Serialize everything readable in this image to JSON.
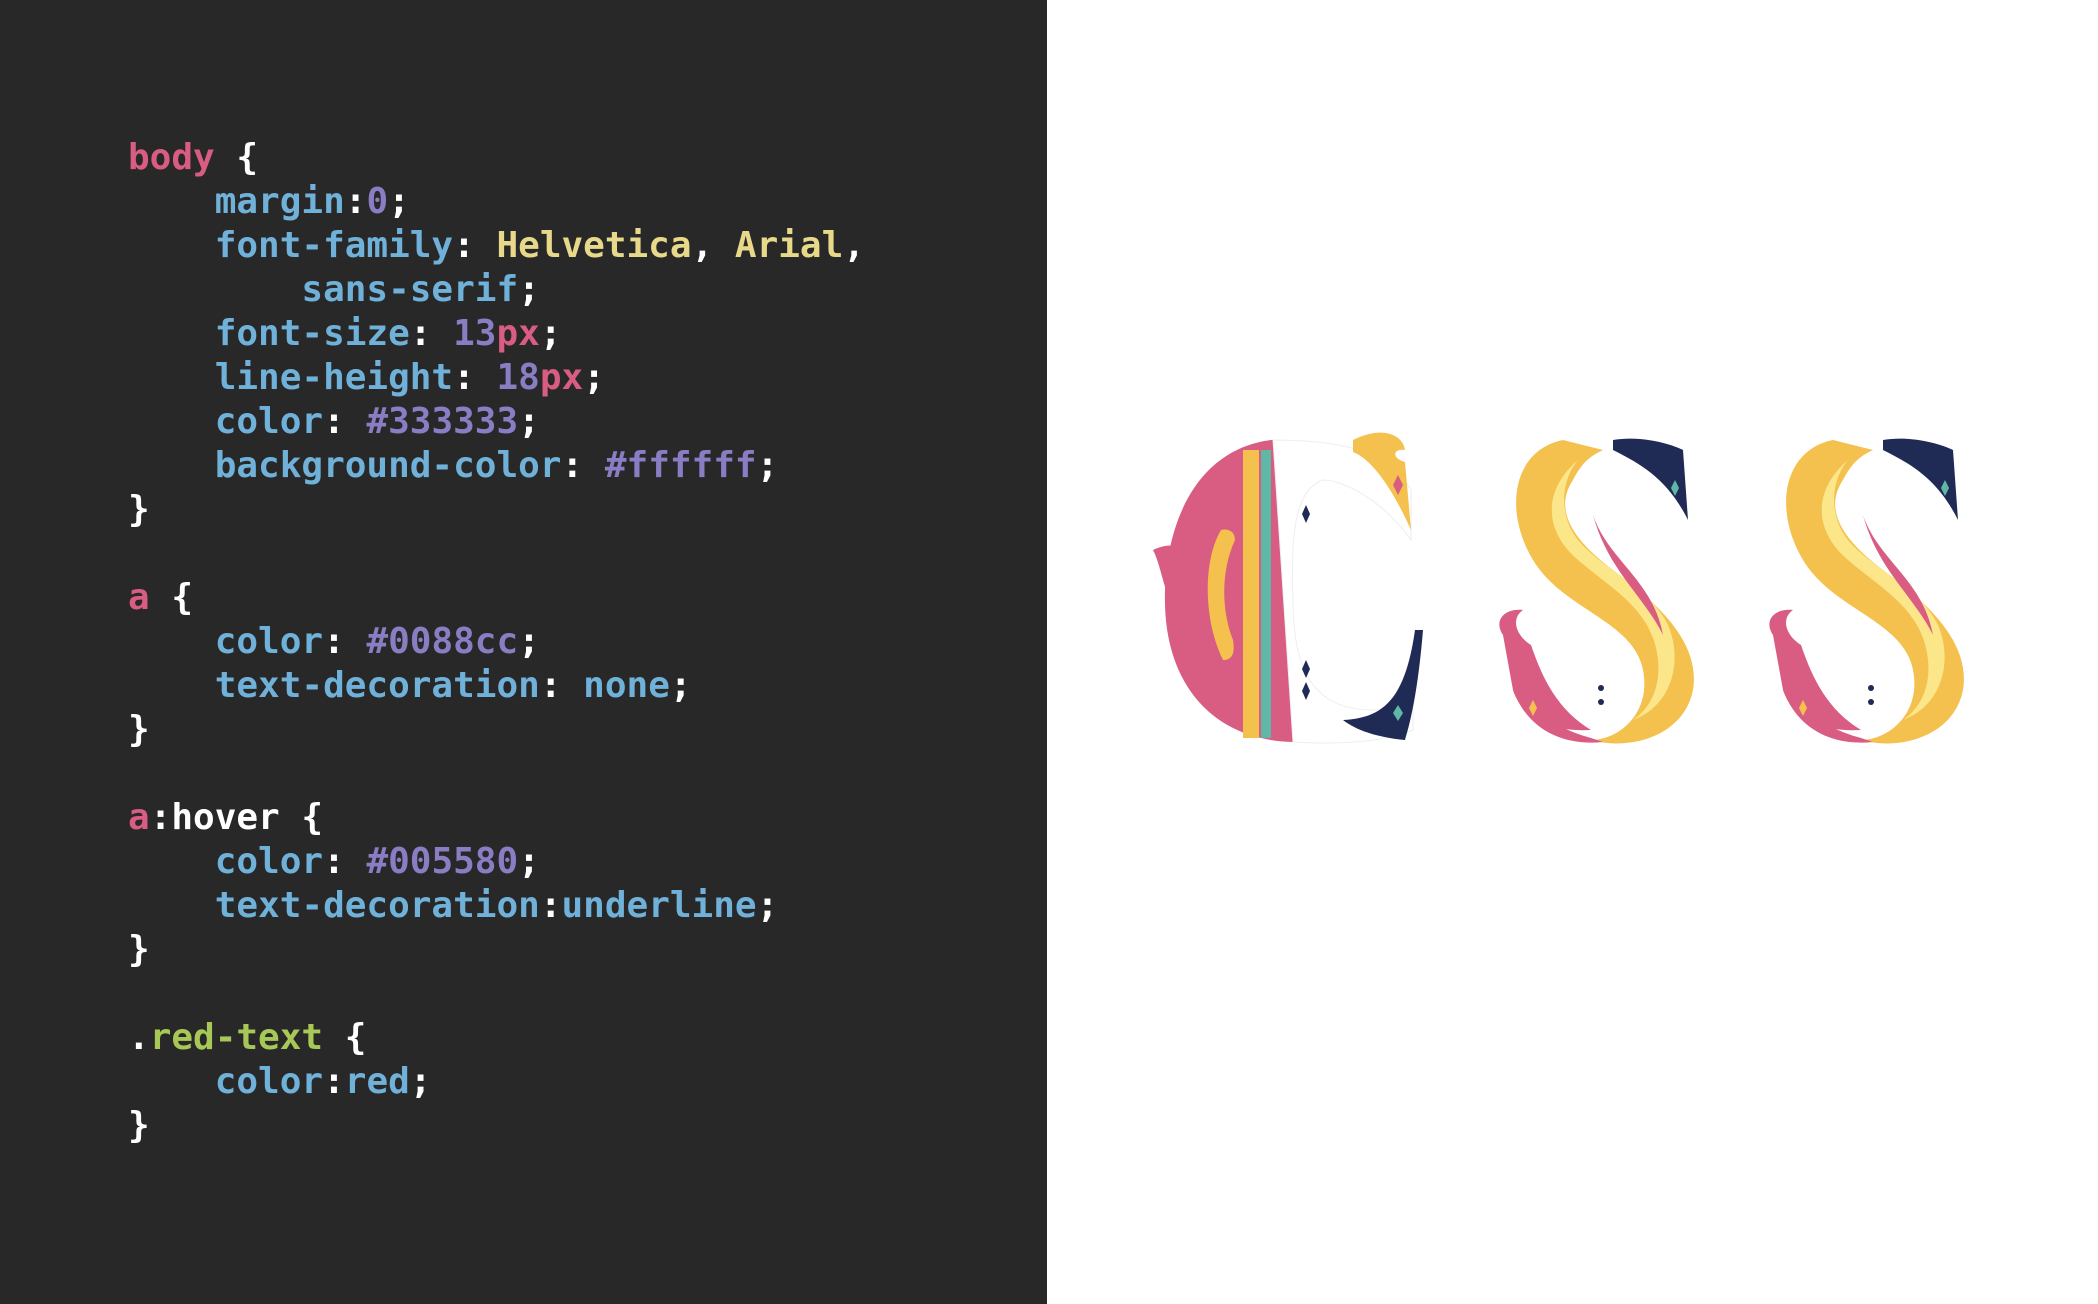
{
  "code_panel": {
    "lines": [
      [
        {
          "t": "body",
          "c": "sel"
        },
        {
          "t": " {",
          "c": "punct"
        }
      ],
      [
        {
          "t": "    margin",
          "c": "prop"
        },
        {
          "t": ":",
          "c": "punct"
        },
        {
          "t": "0",
          "c": "num"
        },
        {
          "t": ";",
          "c": "punct"
        }
      ],
      [
        {
          "t": "    font-family",
          "c": "prop"
        },
        {
          "t": ": ",
          "c": "punct"
        },
        {
          "t": "Helvetica",
          "c": "str"
        },
        {
          "t": ", ",
          "c": "punct"
        },
        {
          "t": "Arial",
          "c": "str"
        },
        {
          "t": ",",
          "c": "punct"
        }
      ],
      [
        {
          "t": "        sans-serif",
          "c": "kw"
        },
        {
          "t": ";",
          "c": "punct"
        }
      ],
      [
        {
          "t": "    font-size",
          "c": "prop"
        },
        {
          "t": ": ",
          "c": "punct"
        },
        {
          "t": "13",
          "c": "num"
        },
        {
          "t": "px",
          "c": "unit"
        },
        {
          "t": ";",
          "c": "punct"
        }
      ],
      [
        {
          "t": "    line-height",
          "c": "prop"
        },
        {
          "t": ": ",
          "c": "punct"
        },
        {
          "t": "18",
          "c": "num"
        },
        {
          "t": "px",
          "c": "unit"
        },
        {
          "t": ";",
          "c": "punct"
        }
      ],
      [
        {
          "t": "    color",
          "c": "prop"
        },
        {
          "t": ": ",
          "c": "punct"
        },
        {
          "t": "#333333",
          "c": "num"
        },
        {
          "t": ";",
          "c": "punct"
        }
      ],
      [
        {
          "t": "    background-color",
          "c": "prop"
        },
        {
          "t": ": ",
          "c": "punct"
        },
        {
          "t": "#ffffff",
          "c": "num"
        },
        {
          "t": ";",
          "c": "punct"
        }
      ],
      [
        {
          "t": "}",
          "c": "punct"
        }
      ],
      [],
      [
        {
          "t": "a",
          "c": "sel"
        },
        {
          "t": " {",
          "c": "punct"
        }
      ],
      [
        {
          "t": "    color",
          "c": "prop"
        },
        {
          "t": ": ",
          "c": "punct"
        },
        {
          "t": "#0088cc",
          "c": "num"
        },
        {
          "t": ";",
          "c": "punct"
        }
      ],
      [
        {
          "t": "    text-decoration",
          "c": "prop"
        },
        {
          "t": ": ",
          "c": "punct"
        },
        {
          "t": "none",
          "c": "kw"
        },
        {
          "t": ";",
          "c": "punct"
        }
      ],
      [
        {
          "t": "}",
          "c": "punct"
        }
      ],
      [],
      [
        {
          "t": "a",
          "c": "sel"
        },
        {
          "t": ":hover {",
          "c": "plain"
        }
      ],
      [
        {
          "t": "    color",
          "c": "prop"
        },
        {
          "t": ": ",
          "c": "punct"
        },
        {
          "t": "#005580",
          "c": "num"
        },
        {
          "t": ";",
          "c": "punct"
        }
      ],
      [
        {
          "t": "    text-decoration",
          "c": "prop"
        },
        {
          "t": ":",
          "c": "punct"
        },
        {
          "t": "underline",
          "c": "kw"
        },
        {
          "t": ";",
          "c": "punct"
        }
      ],
      [
        {
          "t": "}",
          "c": "punct"
        }
      ],
      [],
      [
        {
          "t": ".",
          "c": "plain"
        },
        {
          "t": "red-text",
          "c": "class"
        },
        {
          "t": " {",
          "c": "punct"
        }
      ],
      [
        {
          "t": "    color",
          "c": "prop"
        },
        {
          "t": ":",
          "c": "punct"
        },
        {
          "t": "red",
          "c": "kw"
        },
        {
          "t": ";",
          "c": "punct"
        }
      ],
      [
        {
          "t": "}",
          "c": "punct"
        }
      ]
    ]
  },
  "logo": {
    "text": "CSS",
    "colors": {
      "pink": "#d95c83",
      "yellow": "#f4c04e",
      "light_yellow": "#fbe78a",
      "navy": "#1f2a55",
      "teal": "#5fb8a5",
      "white": "#ffffff"
    }
  },
  "theme": {
    "editor_background": "#282828",
    "selector": "#d95c83",
    "class_selector": "#a7c756",
    "property": "#6fb1d9",
    "string": "#e8d98a",
    "number": "#8a7dc4"
  }
}
